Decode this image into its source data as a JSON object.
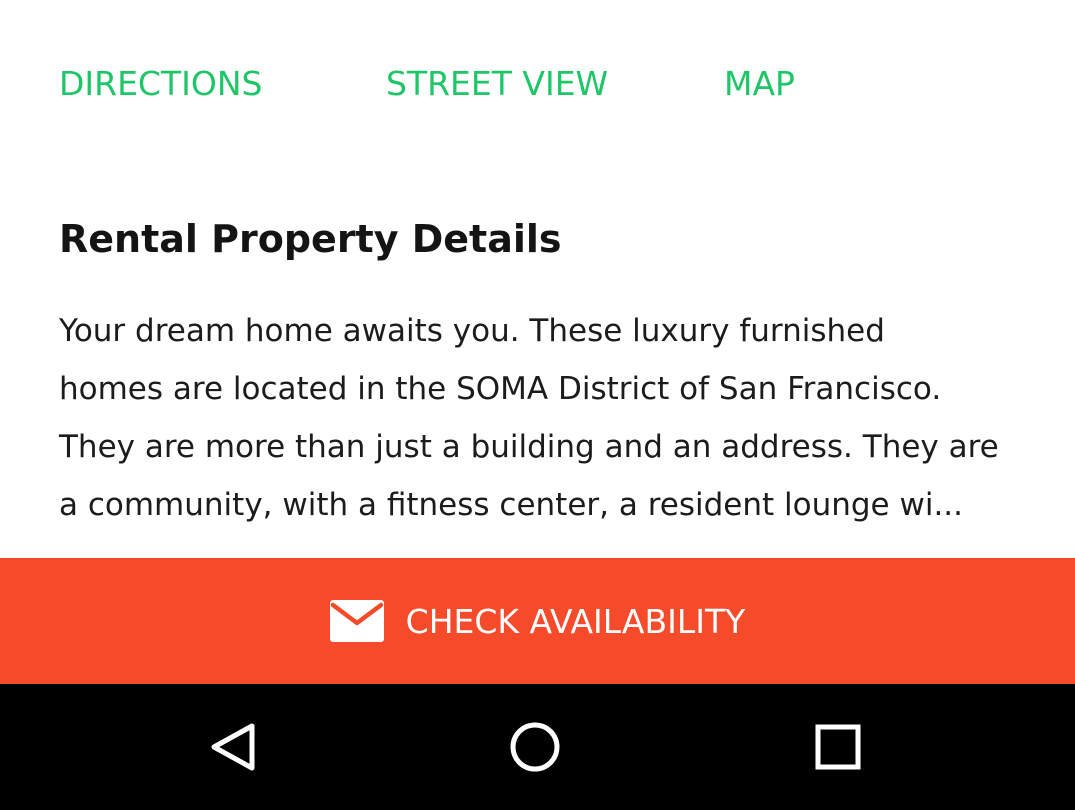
{
  "actions": {
    "directions": "DIRECTIONS",
    "street_view": "STREET VIEW",
    "map": "MAP"
  },
  "details": {
    "title": "Rental Property Details",
    "description_lines": [
      "Your dream home awaits you. These luxury furnished",
      "homes are located in the SOMA District of San Francisco.",
      "They are more than just a building and an address. They are",
      "a community, with a fitness center, a resident lounge wi..."
    ]
  },
  "cta": {
    "label": "CHECK AVAILABILITY",
    "icon": "mail-icon"
  },
  "navbar": {
    "icons": [
      "back-icon",
      "home-icon",
      "recents-icon"
    ]
  },
  "colors": {
    "accent_green": "#1ec668",
    "cta_orange": "#f54b2a",
    "nav_background": "#000000"
  }
}
